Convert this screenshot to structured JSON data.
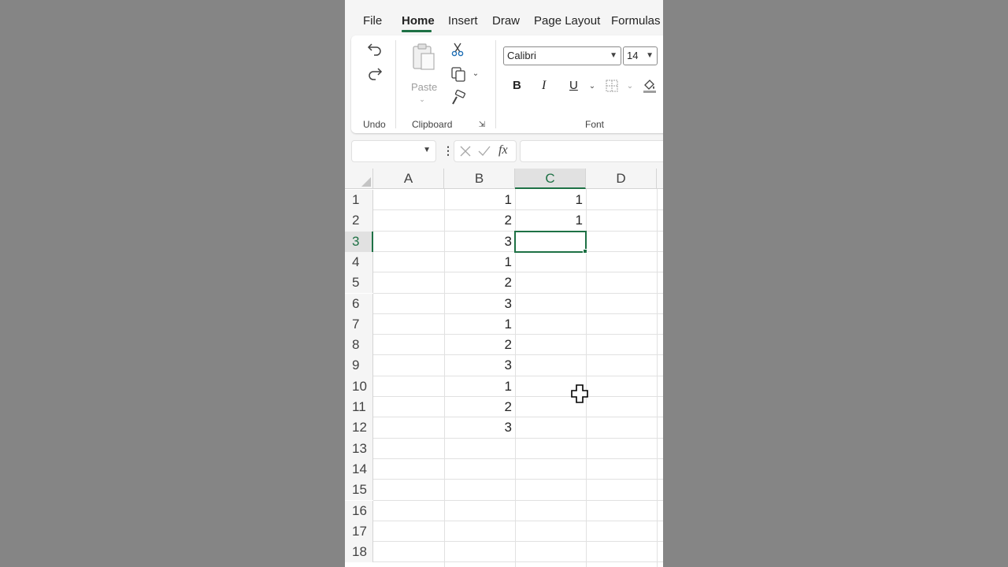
{
  "ribbon": {
    "tabs": [
      {
        "label": "File"
      },
      {
        "label": "Home"
      },
      {
        "label": "Insert"
      },
      {
        "label": "Draw"
      },
      {
        "label": "Page Layout"
      },
      {
        "label": "Formulas"
      }
    ],
    "active_tab": "Home",
    "groups": {
      "undo": {
        "label": "Undo"
      },
      "clipboard": {
        "label": "Clipboard",
        "paste_label": "Paste"
      },
      "font": {
        "label": "Font",
        "font_name": "Calibri",
        "font_size": "14"
      }
    },
    "format_buttons": {
      "bold": "B",
      "italic": "I",
      "underline": "U"
    }
  },
  "formula_bar": {
    "name_box": "",
    "fx": "fx",
    "formula": ""
  },
  "grid": {
    "columns": [
      "A",
      "B",
      "C",
      "D"
    ],
    "selected_column": "C",
    "rows": [
      "1",
      "2",
      "3",
      "4",
      "5",
      "6",
      "7",
      "8",
      "9",
      "10",
      "11",
      "12",
      "13",
      "14",
      "15",
      "16",
      "17",
      "18"
    ],
    "selected_row": "3",
    "column_b": [
      "1",
      "2",
      "3",
      "1",
      "2",
      "3",
      "1",
      "2",
      "3",
      "1",
      "2",
      "3"
    ],
    "column_c": [
      "1",
      "1"
    ]
  },
  "colors": {
    "accent": "#1e7145",
    "background": "#858585"
  }
}
